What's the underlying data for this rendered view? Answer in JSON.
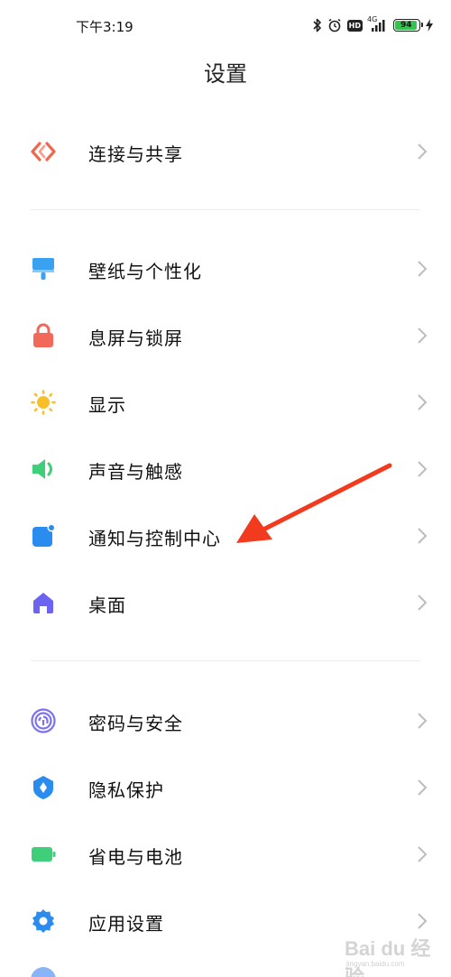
{
  "status_bar": {
    "time": "下午3:19",
    "network": "4G",
    "battery": "94",
    "battery_level_percent": 94,
    "icons": [
      "bluetooth-icon",
      "alarm-icon",
      "hd-icon",
      "signal-icon",
      "battery-icon",
      "charging-icon"
    ]
  },
  "header": {
    "title": "设置"
  },
  "groups": [
    {
      "items": [
        {
          "label": "连接与共享",
          "icon": "share-connect-icon",
          "color": "#ee6a4f"
        }
      ]
    },
    {
      "items": [
        {
          "label": "壁纸与个性化",
          "icon": "wallpaper-brush-icon",
          "color": "#3aa0f0"
        },
        {
          "label": "息屏与锁屏",
          "icon": "lock-icon",
          "color": "#f2695a"
        },
        {
          "label": "显示",
          "icon": "sun-icon",
          "color": "#f7c02b"
        },
        {
          "label": "声音与触感",
          "icon": "speaker-icon",
          "color": "#3fcf7a"
        },
        {
          "label": "通知与控制中心",
          "icon": "notification-icon",
          "color": "#2b8cf0"
        },
        {
          "label": "桌面",
          "icon": "home-icon",
          "color": "#6d63f2"
        }
      ]
    },
    {
      "items": [
        {
          "label": "密码与安全",
          "icon": "fingerprint-icon",
          "color": "#7c72f0"
        },
        {
          "label": "隐私保护",
          "icon": "privacy-shield-icon",
          "color": "#2b8cf0"
        },
        {
          "label": "省电与电池",
          "icon": "battery-saver-icon",
          "color": "#3fcf7a"
        },
        {
          "label": "应用设置",
          "icon": "app-settings-gear-icon",
          "color": "#2b8cf0"
        }
      ]
    }
  ],
  "annotation": {
    "arrow_color": "#f23a1f"
  },
  "watermark": {
    "text": "Bai du 经验",
    "sub": "jingyan.baidu.com"
  }
}
